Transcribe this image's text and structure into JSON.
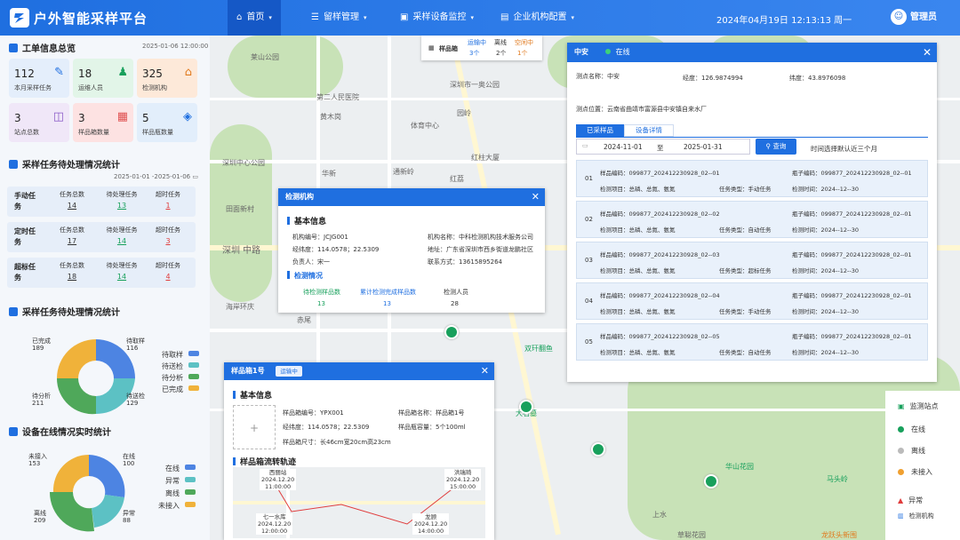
{
  "header": {
    "app_title": "户外智能采样平台",
    "nav": [
      {
        "label": "首页",
        "icon": "home-icon"
      },
      {
        "label": "留样管理",
        "icon": "sliders-icon"
      },
      {
        "label": "采样设备监控",
        "icon": "monitor-icon"
      },
      {
        "label": "企业机构配置",
        "icon": "building-icon"
      }
    ],
    "datetime": "2024年04月19日  12:13:13  周一",
    "user": "管理员"
  },
  "work_overview": {
    "title": "工单信息总览",
    "date": "2025-01-06 12:00:00",
    "cards": [
      {
        "value": "112",
        "label": "本月采样任务",
        "icon": "pipette-icon",
        "bg": "#e4eefb",
        "color": "#1f6fe0"
      },
      {
        "value": "18",
        "label": "运维人员",
        "icon": "person-icon",
        "bg": "#e2f5e8",
        "color": "#18a05c"
      },
      {
        "value": "325",
        "label": "检测机构",
        "icon": "bank-icon",
        "bg": "#fde9d9",
        "color": "#e07a1f"
      },
      {
        "value": "3",
        "label": "站点总数",
        "icon": "station-icon",
        "bg": "#f0e7f8",
        "color": "#8a5bc7"
      },
      {
        "value": "3",
        "label": "样品箱数量",
        "icon": "box-icon",
        "bg": "#fde2e2",
        "color": "#e05252"
      },
      {
        "value": "5",
        "label": "样品瓶数量",
        "icon": "cube-icon",
        "bg": "#e2eefb",
        "color": "#1f6fe0"
      }
    ]
  },
  "pending": {
    "title": "采样任务待处理情况统计",
    "date_range": "2025-01-01 -2025-01-06",
    "col_labels": [
      "任务总数",
      "待处理任务",
      "超时任务"
    ],
    "rows": [
      {
        "label": "手动任务",
        "values": [
          "14",
          "13",
          "1"
        ]
      },
      {
        "label": "定时任务",
        "values": [
          "17",
          "14",
          "3"
        ]
      },
      {
        "label": "超标任务",
        "values": [
          "18",
          "14",
          "4"
        ]
      }
    ]
  },
  "pending_chart": {
    "title": "采样任务待处理情况统计",
    "legend": [
      {
        "label": "待取样",
        "color": "#4d84e2"
      },
      {
        "label": "待送检",
        "color": "#5cc1c4"
      },
      {
        "label": "待分析",
        "color": "#4fa85a"
      },
      {
        "label": "已完成",
        "color": "#f0b23a"
      }
    ],
    "labels": [
      {
        "name": "已完成",
        "value": "189"
      },
      {
        "name": "待取样",
        "value": "116"
      },
      {
        "name": "待送检",
        "value": "129"
      },
      {
        "name": "待分析",
        "value": "211"
      }
    ]
  },
  "device_chart": {
    "title": "设备在线情况实时统计",
    "legend": [
      {
        "label": "在线",
        "color": "#4d84e2"
      },
      {
        "label": "异常",
        "color": "#5cc1c4"
      },
      {
        "label": "离线",
        "color": "#4fa85a"
      },
      {
        "label": "未接入",
        "color": "#f0b23a"
      }
    ],
    "labels": [
      {
        "name": "未接入",
        "value": "153"
      },
      {
        "name": "在线",
        "value": "100"
      },
      {
        "name": "异常",
        "value": "88"
      },
      {
        "name": "离线",
        "value": "209"
      }
    ]
  },
  "map": {
    "labels": [
      "莱山公园",
      "第二人民医院",
      "黄木岗",
      "体育中心",
      "园岭",
      "深圳市一奥公园",
      "华新",
      "通新岭",
      "红荔",
      "红柱大厦",
      "深圳中心公园",
      "田面新村",
      "深圳 中路",
      "海岸环庆",
      "赤尾",
      "双玕翻鱼",
      "大石墓",
      "华山花园",
      "马头岭",
      "上水",
      "草聪花园",
      "龙跃头新围"
    ]
  },
  "sample_head": {
    "label": "样品箱",
    "stats": [
      {
        "label": "运输中",
        "value": "3个"
      },
      {
        "label": "离线",
        "value": "2个"
      },
      {
        "label": "空闲中",
        "value": "1个"
      }
    ]
  },
  "lab_popup": {
    "title": "检测机构",
    "section1": "基本信息",
    "fields": [
      "机构编号：JCJG001",
      "机构名称：中科检测机构技术服务公司",
      "经纬度：114.0578；22.5309",
      "地址：广东省深圳市西乡街道龙鹏社区",
      "负责人：宋一",
      "联系方式：13615895264"
    ],
    "section2": "检测情况",
    "stats": [
      {
        "label": "待检测样品数",
        "value": "13"
      },
      {
        "label": "累计检测完成样品数",
        "value": "13"
      },
      {
        "label": "检测人员",
        "value": "28"
      }
    ]
  },
  "box_popup": {
    "title": "样品箱1号",
    "status": "运输中",
    "section1": "基本信息",
    "fields": [
      "样品箱编号：YPX001",
      "样品箱名称：样品箱1号",
      "经纬度：114.0578；22.5309",
      "样品瓶容量：5个100ml",
      "样品箱尺寸：长46cm宽20cm高23cm"
    ],
    "section2": "样品箱流转轨迹",
    "track": [
      {
        "place": "西丽站",
        "date": "2024.12.20",
        "time": "11:00:00"
      },
      {
        "place": "洪瑞琦",
        "date": "2024.12.20",
        "time": "15:00:00"
      },
      {
        "place": "七一水库",
        "date": "2024.12.20",
        "time": "12:00:00"
      },
      {
        "place": "龙顾",
        "date": "2024.12.20",
        "time": "14:00:00"
      }
    ]
  },
  "site_popup": {
    "title": "中安",
    "status": "在线",
    "name": "测点名称：中安",
    "lng": "经度：126.9874994",
    "lat": "纬度：43.8976098",
    "address": "测点位置：云南省曲靖市富源县中安镇自来水厂",
    "tabs": [
      "已采样品",
      "设备详情"
    ],
    "date_from": "2024-11-01",
    "date_sep": "至",
    "date_to": "2025-01-31",
    "query": "查询",
    "hint": "时间选择默认近三个月",
    "records": [
      {
        "no": "01",
        "sample": "样品编码：099877_202412230928_02--01",
        "bottle": "瓶子编码：099877_202412230928_02--01",
        "items": "检测项目：总磷、总氮、氨氮",
        "type": "任务类型：手动任务",
        "time": "检测时间：2024--12--30"
      },
      {
        "no": "02",
        "sample": "样品编码：099877_202412230928_02--02",
        "bottle": "瓶子编码：099877_202412230928_02--01",
        "items": "检测项目：总磷、总氮、氨氮",
        "type": "任务类型：自动任务",
        "time": "检测时间：2024--12--30"
      },
      {
        "no": "03",
        "sample": "样品编码：099877_202412230928_02--03",
        "bottle": "瓶子编码：099877_202412230928_02--01",
        "items": "检测项目：总磷、总氮、氨氮",
        "type": "任务类型：超标任务",
        "time": "检测时间：2024--12--30"
      },
      {
        "no": "04",
        "sample": "样品编码：099877_202412230928_02--04",
        "bottle": "瓶子编码：099877_202412230928_02--01",
        "items": "检测项目：总磷、总氮、氨氮",
        "type": "任务类型：手动任务",
        "time": "检测时间：2024--12--30"
      },
      {
        "no": "05",
        "sample": "样品编码：099877_202412230928_02--05",
        "bottle": "瓶子编码：099877_202412230928_02--01",
        "items": "检测项目：总磷、总氮、氨氮",
        "type": "任务类型：自动任务",
        "time": "检测时间：2024--12--30"
      }
    ]
  },
  "map_legend": [
    {
      "label": "监测站点",
      "color": "#18a05c",
      "icon": "station-pin-icon"
    },
    {
      "label": "在线",
      "color": "#18a05c",
      "icon": "dot-icon"
    },
    {
      "label": "离线",
      "color": "#bbbbbb",
      "icon": "dot-icon"
    },
    {
      "label": "未接入",
      "color": "#f0a030",
      "icon": "dot-icon"
    },
    {
      "label": "异常",
      "color": "#e03c3c",
      "icon": "warning-icon"
    },
    {
      "label": "检测机构",
      "color": "#1f6fe0",
      "icon": "lab-icon"
    }
  ]
}
